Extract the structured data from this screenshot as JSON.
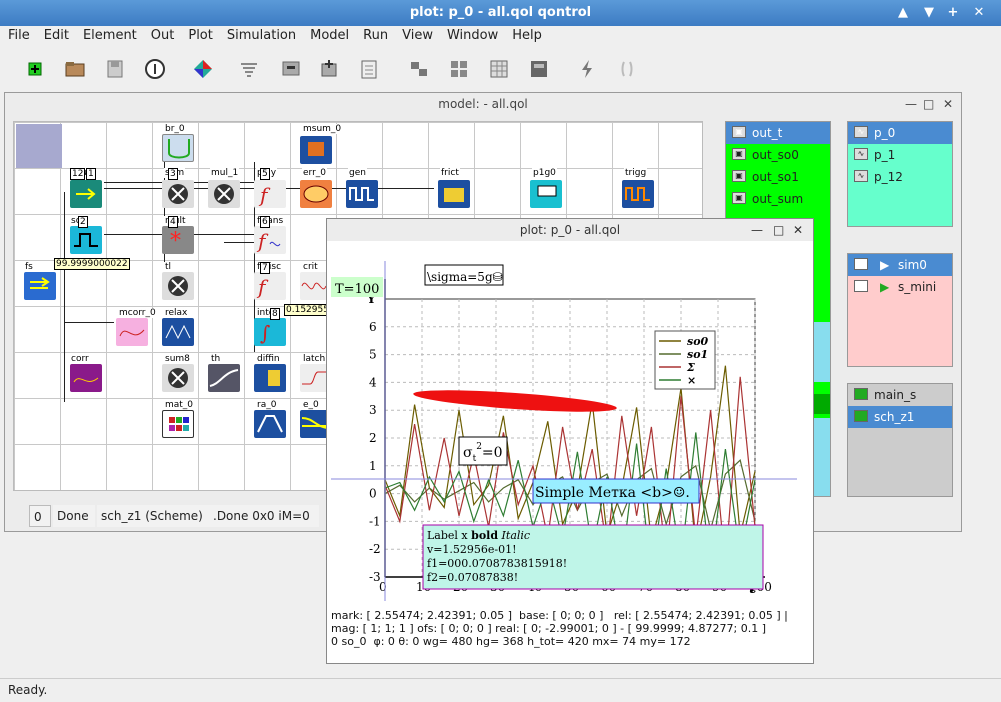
{
  "app": {
    "title": "plot: p_0 - all.qol qontrol",
    "window_buttons": [
      "▲",
      "▼",
      "+",
      "✕"
    ]
  },
  "menu": [
    "File",
    "Edit",
    "Element",
    "Out",
    "Plot",
    "Simulation",
    "Model",
    "Run",
    "View",
    "Window",
    "Help"
  ],
  "toolbar_icons": [
    "new-icon",
    "open-icon",
    "save-icon",
    "info-icon",
    "color-icon",
    "filter-icon",
    "monitor-icon",
    "add-element-icon",
    "properties-icon",
    "link-icon",
    "grid-icon",
    "table-icon",
    "chip-icon",
    "run-icon",
    "pause-icon"
  ],
  "model_window": {
    "title": "model:  - all.qol",
    "status": {
      "num": "0",
      "state": "Done",
      "scheme": "sch_z1 (Scheme)",
      "detail": ".Done 0x0 iM=0"
    },
    "elements": [
      {
        "name": "br_0"
      },
      {
        "name": "msum_0"
      },
      {
        "name": "sou"
      },
      {
        "name": "sum"
      },
      {
        "name": "mul_1"
      },
      {
        "name": "poly"
      },
      {
        "name": "err_0"
      },
      {
        "name": "gen"
      },
      {
        "name": "frict"
      },
      {
        "name": "p1g0"
      },
      {
        "name": "trigg"
      },
      {
        "name": "so1"
      },
      {
        "name": "mult"
      },
      {
        "name": "ftrans"
      },
      {
        "name": "fs"
      },
      {
        "name": "tl"
      },
      {
        "name": "fmisc"
      },
      {
        "name": "crit"
      },
      {
        "name": "mcorr_0"
      },
      {
        "name": "relax"
      },
      {
        "name": "intg"
      },
      {
        "name": "corr"
      },
      {
        "name": "sum8"
      },
      {
        "name": "th"
      },
      {
        "name": "diffin"
      },
      {
        "name": "latch"
      },
      {
        "name": "mat_0"
      },
      {
        "name": "ra_0"
      },
      {
        "name": "e_0"
      }
    ],
    "numbers": [
      "12",
      "1",
      "3",
      "5",
      "2",
      "4",
      "6",
      "7",
      "8"
    ],
    "value_labels": [
      "99.9999000022",
      "0.152955"
    ]
  },
  "outputs": {
    "items": [
      {
        "label": "out_t",
        "selected": true
      },
      {
        "label": "out_so0",
        "selected": false
      },
      {
        "label": "out_so1",
        "selected": false
      },
      {
        "label": "out_sum",
        "selected": false
      }
    ]
  },
  "plots": {
    "items": [
      {
        "label": "p_0",
        "selected": true
      },
      {
        "label": "p_1",
        "selected": false
      },
      {
        "label": "p_12",
        "selected": false
      }
    ]
  },
  "sims": {
    "items": [
      {
        "label": "sim0",
        "selected": true
      },
      {
        "label": "s_mini",
        "selected": false
      }
    ]
  },
  "schemes": {
    "items": [
      {
        "label": "main_s",
        "selected": false
      },
      {
        "label": "sch_z1",
        "selected": true
      }
    ]
  },
  "plot_window": {
    "title": "plot: p_0 - all.qol",
    "labels": {
      "t_label": "T=100",
      "sigma_label": "\\sigma=5g⛁",
      "sigma_formula": "σ",
      "sigma_sub": "t",
      "sigma_rest": "=0",
      "simple_label": "Simple Метка <b>☺.",
      "box_line1_a": "Label x ",
      "box_line1_b": "bold",
      "box_line1_c": "Italic",
      "box_line2": "v=1.52956e-01!",
      "box_line3": "f1=000.0708783815918!",
      "box_line4": "f2=0.07087838!",
      "y_axis": "Y",
      "x_axis": "t"
    },
    "legend": [
      {
        "name": "so0",
        "color": "#6b5c00"
      },
      {
        "name": "so1",
        "color": "#556b2f"
      },
      {
        "name": "Σ",
        "color": "#a33"
      },
      {
        "name": "×",
        "color": "#2e7d32"
      }
    ],
    "info": {
      "line1": "mark: [ 2.55474; 2.42391; 0.05 ]  base: [ 0; 0; 0 ]   rel: [ 2.55474; 2.42391; 0.05 ] |",
      "line2": "mag: [ 1; 1; 1 ] ofs: [ 0; 0; 0 ] real: [ 0; -2.99001; 0 ] - [ 99.9999; 4.87277; 0.1 ]",
      "line3": "0 so_0  φ: 0 θ: 0 wg= 480 hg= 368 h_tot= 420 mx= 74 my= 172"
    }
  },
  "chart_data": {
    "type": "line",
    "title": "",
    "xlabel": "t",
    "ylabel": "Y",
    "xlim": [
      0,
      100
    ],
    "ylim": [
      -3,
      7
    ],
    "xticks": [
      0,
      10,
      20,
      30,
      40,
      50,
      60,
      70,
      80,
      90,
      100
    ],
    "yticks": [
      -3,
      -2,
      -1,
      0,
      1,
      2,
      3,
      4,
      5,
      6
    ],
    "grid": true,
    "legend_position": "top-right",
    "series": [
      {
        "name": "so0",
        "color": "#6b5c00",
        "x": [
          0,
          4,
          8,
          12,
          16,
          20,
          24,
          28,
          32,
          36,
          40,
          44,
          48,
          52,
          56,
          60,
          64,
          68,
          72,
          76,
          80,
          84,
          88,
          92,
          96,
          100
        ],
        "y": [
          0.5,
          -0.8,
          3.2,
          0.2,
          -0.5,
          3.0,
          -0.4,
          0.3,
          2.8,
          -0.9,
          0.4,
          2.6,
          -1.1,
          0.1,
          3.3,
          -1.5,
          0.2,
          3.1,
          -1.7,
          0.3,
          3.8,
          -2.0,
          0.6,
          4.6,
          -1.5,
          0.8
        ]
      },
      {
        "name": "so1",
        "color": "#556b2f",
        "x": [
          0,
          4,
          8,
          12,
          16,
          20,
          24,
          28,
          32,
          36,
          40,
          44,
          48,
          52,
          56,
          60,
          64,
          68,
          72,
          76,
          80,
          84,
          88,
          92,
          96,
          100
        ],
        "y": [
          0.0,
          0.3,
          -0.3,
          0.2,
          -0.2,
          0.1,
          0.4,
          -0.3,
          0.2,
          0.5,
          -0.4,
          0.3,
          0.6,
          -0.6,
          0.4,
          0.7,
          -0.8,
          0.5,
          0.9,
          -1.1,
          0.6,
          1.0,
          -1.3,
          0.7,
          1.2,
          -1.0
        ]
      },
      {
        "name": "Σ",
        "color": "#a33",
        "x": [
          0,
          4,
          8,
          12,
          16,
          20,
          24,
          28,
          32,
          36,
          40,
          44,
          48,
          52,
          56,
          60,
          64,
          68,
          72,
          76,
          80,
          84,
          88,
          92,
          96,
          100
        ],
        "y": [
          0.3,
          -1.0,
          2.5,
          -0.6,
          2.0,
          -0.8,
          1.4,
          -1.2,
          2.2,
          -0.4,
          1.0,
          -1.6,
          2.4,
          -0.6,
          1.6,
          -2.0,
          2.8,
          -0.8,
          2.4,
          -2.4,
          3.5,
          -1.6,
          3.0,
          -2.6,
          4.2,
          -1.2
        ]
      },
      {
        "name": "×",
        "color": "#2e7d32",
        "x": [
          0,
          4,
          8,
          12,
          16,
          20,
          24,
          28,
          32,
          36,
          40,
          44,
          48,
          52,
          56,
          60,
          64,
          68,
          72,
          76,
          80,
          84,
          88,
          92,
          96,
          100
        ],
        "y": [
          0.2,
          0.4,
          -0.6,
          0.6,
          -0.3,
          0.8,
          -1.0,
          0.5,
          -0.8,
          1.2,
          -1.2,
          0.4,
          -1.6,
          1.5,
          -2.0,
          0.6,
          -2.6,
          1.8,
          -2.9,
          0.9,
          -2.4,
          2.2,
          -2.8,
          1.6,
          -2.2,
          0.5
        ]
      }
    ]
  }
}
